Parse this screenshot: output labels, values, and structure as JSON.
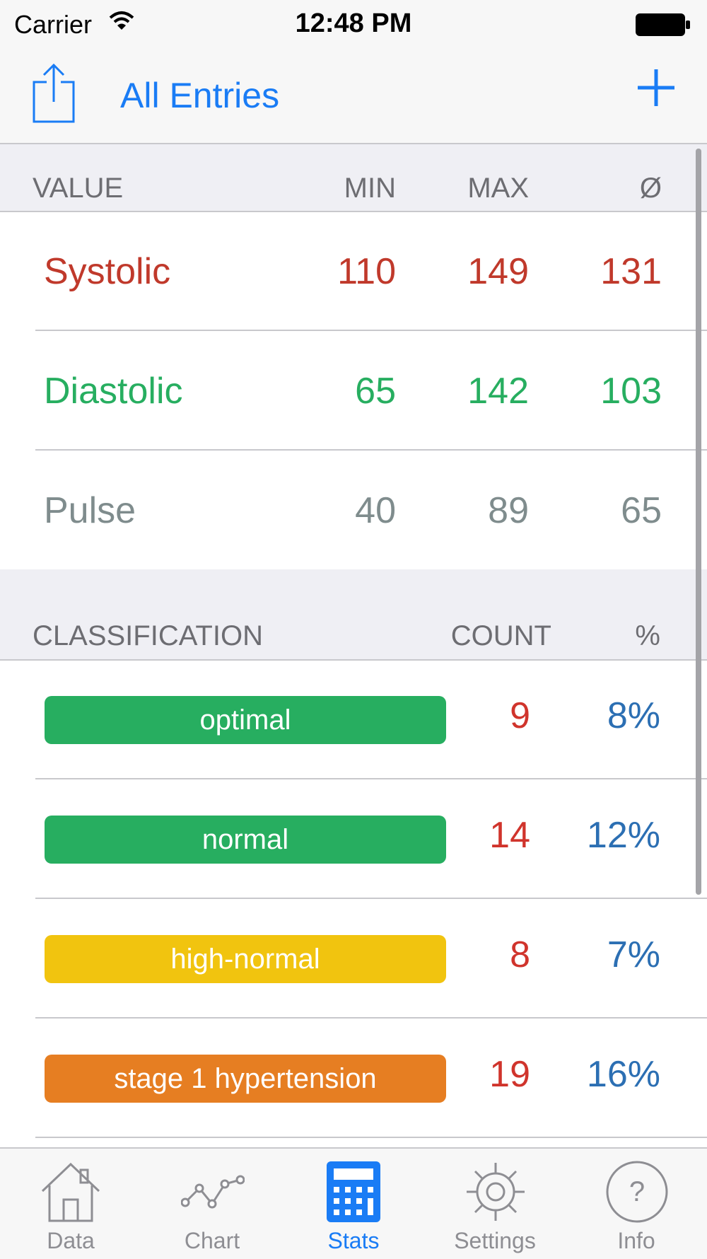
{
  "status": {
    "carrier": "Carrier",
    "time": "12:48 PM"
  },
  "nav": {
    "title": "All Entries"
  },
  "values_header": {
    "value": "VALUE",
    "min": "MIN",
    "max": "MAX",
    "avg": "Ø"
  },
  "values": [
    {
      "label": "Systolic",
      "min": "110",
      "max": "149",
      "avg": "131",
      "color": "#c0392b"
    },
    {
      "label": "Diastolic",
      "min": "65",
      "max": "142",
      "avg": "103",
      "color": "#27ae60"
    },
    {
      "label": "Pulse",
      "min": "40",
      "max": "89",
      "avg": "65",
      "color": "#7f8c8d"
    }
  ],
  "class_header": {
    "classification": "CLASSIFICATION",
    "count": "COUNT",
    "pct": "%"
  },
  "classifications": [
    {
      "label": "optimal",
      "count": "9",
      "pct": "8%",
      "color": "#27ae60"
    },
    {
      "label": "normal",
      "count": "14",
      "pct": "12%",
      "color": "#27ae60"
    },
    {
      "label": "high-normal",
      "count": "8",
      "pct": "7%",
      "color": "#f1c40f"
    },
    {
      "label": "stage 1 hypertension",
      "count": "19",
      "pct": "16%",
      "color": "#e67e22"
    }
  ],
  "tabs": [
    {
      "label": "Data",
      "icon": "house-icon",
      "active": false
    },
    {
      "label": "Chart",
      "icon": "line-chart-icon",
      "active": false
    },
    {
      "label": "Stats",
      "icon": "calculator-icon",
      "active": true
    },
    {
      "label": "Settings",
      "icon": "gear-icon",
      "active": false
    },
    {
      "label": "Info",
      "icon": "question-icon",
      "active": false
    }
  ],
  "colors": {
    "accent": "#1a7cf5",
    "inactive": "#8e8e93"
  }
}
